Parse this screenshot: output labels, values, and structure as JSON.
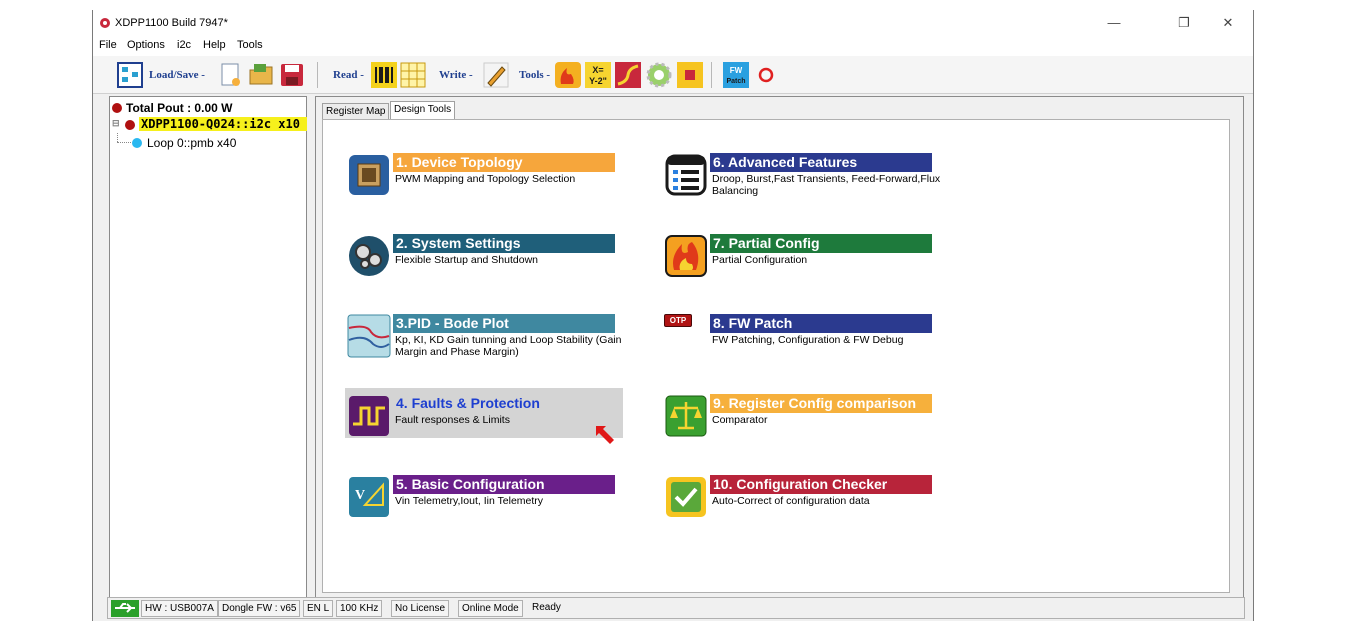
{
  "window": {
    "title": "XDPP1100 Build 7947*",
    "minimize": "—",
    "restore": "❐",
    "close": "✕"
  },
  "menu": [
    "File",
    "Options",
    "i2c",
    "Help",
    "Tools"
  ],
  "toolbar": {
    "load_save": "Load/Save -",
    "read": "Read -",
    "write": "Write -",
    "tools": "Tools -",
    "fw_patch_line1": "FW",
    "fw_patch_line2": "Patch",
    "xy_line1": "X=",
    "xy_line2": "Y-2\""
  },
  "tree": {
    "total_pout": "Total Pout : 0.00 W",
    "device": "XDPP1100-Q024::i2c x10",
    "loop": "Loop 0::pmb x40"
  },
  "tabs": [
    "Register Map",
    "Design Tools"
  ],
  "cards": [
    {
      "title": "1. Device Topology",
      "desc": "PWM Mapping and Topology Selection",
      "color": "#f6a63c",
      "icon": "chip-icon"
    },
    {
      "title": "2. System Settings",
      "desc": "Flexible Startup and Shutdown",
      "color": "#1f5f7a",
      "icon": "gears-icon"
    },
    {
      "title": "3.PID - Bode Plot",
      "desc": "Kp, KI, KD Gain tunning and Loop Stability (Gain Margin and Phase Margin)",
      "color": "#3f88a0",
      "icon": "bode-icon"
    },
    {
      "title": "4. Faults & Protection",
      "desc": "Fault responses & Limits",
      "color": "#d9d9d9",
      "icon": "waveform-icon"
    },
    {
      "title": "5. Basic Configuration",
      "desc": "Vin Telemetry,Iout, Iin Telemetry",
      "color": "#6a1f8a",
      "icon": "telemetry-icon"
    },
    {
      "title": "6. Advanced Features",
      "desc": "Droop, Burst,Fast Transients, Feed-Forward,Flux Balancing",
      "color": "#2b3a8f",
      "icon": "list-icon"
    },
    {
      "title": "7. Partial Config",
      "desc": "Partial Configuration",
      "color": "#1e7a3c",
      "icon": "fire-icon"
    },
    {
      "title": "8. FW Patch",
      "desc": "FW Patching, Configuration & FW Debug",
      "color": "#2b3a8f",
      "icon": "otp-icon",
      "badge": "OTP"
    },
    {
      "title": "9. Register Config comparison",
      "desc": "Comparator",
      "color": "#f6b03c",
      "icon": "scale-icon"
    },
    {
      "title": "10. Configuration Checker",
      "desc": "Auto-Correct of configuration data",
      "color": "#b8243a",
      "icon": "checkmark-icon"
    }
  ],
  "status": [
    "HW : USB007A",
    "Dongle FW : v65",
    "EN L",
    "100 KHz",
    "No License",
    "Online Mode",
    "Ready"
  ]
}
